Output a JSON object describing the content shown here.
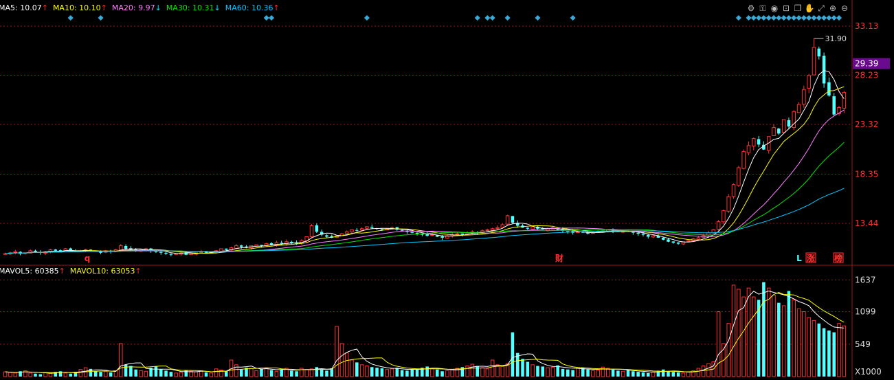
{
  "price_legend": [
    {
      "label": "MA5: 10.07",
      "arrow": "↑",
      "color": "#ffffff",
      "arrow_color": "#ff3232"
    },
    {
      "label": "MA10: 10.10",
      "arrow": "↑",
      "color": "#ffff00",
      "arrow_color": "#ff3232"
    },
    {
      "label": "MA20: 9.97",
      "arrow": "↓",
      "color": "#ff80ff",
      "arrow_color": "#00e5ff"
    },
    {
      "label": "MA30: 10.31",
      "arrow": "↓",
      "color": "#00e600",
      "arrow_color": "#00e5ff"
    },
    {
      "label": "MA60: 10.36",
      "arrow": "↑",
      "color": "#00c8ff",
      "arrow_color": "#ff3232"
    }
  ],
  "vol_legend": [
    {
      "label": "MAVOL5: 60385",
      "arrow": "↑",
      "color": "#ffffff",
      "arrow_color": "#ff3232"
    },
    {
      "label": "MAVOL10: 63053",
      "arrow": "↑",
      "color": "#ffff00",
      "arrow_color": "#ff3232"
    }
  ],
  "price_axis_labels": [
    "33.13",
    "28.23",
    "23.32",
    "18.35",
    "13.44"
  ],
  "price_highlight": "29.39",
  "max_annotation": "31.90",
  "volume_axis_labels": [
    "1637",
    "1099",
    "549"
  ],
  "volume_unit": "X1000",
  "event_markers": [
    "q",
    "财",
    "L",
    "涨",
    "榜"
  ],
  "toolbar_icons": [
    "settings-icon",
    "lock-icon",
    "eye-icon",
    "basket-icon",
    "copy-icon",
    "hand-icon",
    "resize-icon",
    "zoom-in-icon",
    "zoom-out-icon"
  ],
  "colors": {
    "up": "#ff3232",
    "down": "#54ffff",
    "grid": "#a01818",
    "axis_text": "#ff3232",
    "highlight_bg": "#6a0a8c"
  },
  "chart_data": [
    {
      "type": "candlestick",
      "y_axis_ticks": [
        33.13,
        28.23,
        23.32,
        18.35,
        13.44
      ],
      "ylim": [
        9.8,
        34.5
      ],
      "max_value": 31.9,
      "current_price": 29.39,
      "close_series": [
        10.4,
        10.5,
        10.6,
        10.4,
        10.5,
        10.7,
        10.6,
        10.5,
        10.6,
        10.8,
        10.7,
        10.6,
        10.9,
        10.7,
        10.6,
        10.7,
        10.8,
        10.7,
        10.6,
        10.5,
        10.7,
        10.6,
        10.8,
        11.2,
        10.9,
        10.8,
        10.7,
        10.8,
        10.9,
        10.7,
        10.6,
        10.5,
        10.4,
        10.3,
        10.4,
        10.5,
        10.3,
        10.4,
        10.5,
        10.6,
        10.5,
        10.6,
        10.7,
        10.9,
        10.8,
        11.0,
        11.2,
        11.1,
        11.0,
        11.2,
        11.3,
        11.2,
        11.4,
        11.3,
        11.5,
        11.4,
        11.6,
        11.5,
        11.4,
        11.7,
        12.1,
        13.2,
        12.6,
        12.3,
        12.1,
        12.0,
        12.2,
        12.4,
        12.6,
        12.8,
        12.7,
        12.9,
        13.1,
        13.0,
        12.9,
        12.8,
        12.9,
        13.0,
        12.8,
        12.7,
        12.6,
        12.5,
        12.4,
        12.3,
        12.2,
        12.3,
        12.1,
        12.0,
        12.2,
        12.3,
        12.4,
        12.3,
        12.5,
        12.6,
        12.5,
        12.7,
        12.8,
        12.9,
        13.0,
        13.3,
        14.2,
        13.5,
        13.2,
        13.0,
        12.9,
        13.1,
        12.9,
        12.8,
        12.9,
        13.0,
        12.8,
        12.7,
        12.6,
        12.5,
        12.6,
        12.5,
        12.4,
        12.5,
        12.6,
        12.7,
        12.8,
        12.7,
        12.6,
        12.7,
        12.6,
        12.5,
        12.4,
        12.3,
        12.1,
        12.2,
        12.0,
        11.8,
        11.6,
        11.5,
        11.4,
        11.6,
        11.7,
        11.9,
        12.0,
        12.2,
        12.5,
        12.8,
        13.6,
        14.7,
        16.1,
        17.3,
        19.0,
        20.6,
        21.2,
        21.9,
        21.3,
        20.8,
        22.1,
        23.0,
        22.4,
        23.8,
        23.1,
        24.6,
        25.3,
        26.8,
        28.2,
        31.0,
        30.1,
        27.4,
        26.2,
        24.3,
        25.0,
        26.5
      ],
      "ma_series": [
        "MA5",
        "MA10",
        "MA20",
        "MA30",
        "MA60"
      ]
    },
    {
      "type": "bar",
      "y_axis_ticks": [
        1637,
        1099,
        549
      ],
      "ylim": [
        0,
        1700
      ],
      "unit": "X1000",
      "values": [
        80,
        70,
        60,
        90,
        100,
        60,
        50,
        40,
        70,
        60,
        80,
        90,
        60,
        50,
        80,
        120,
        150,
        130,
        90,
        80,
        90,
        70,
        100,
        560,
        200,
        180,
        120,
        100,
        90,
        150,
        170,
        120,
        100,
        80,
        60,
        70,
        110,
        90,
        80,
        100,
        70,
        60,
        130,
        110,
        90,
        280,
        200,
        120,
        150,
        140,
        100,
        130,
        150,
        110,
        90,
        120,
        140,
        100,
        90,
        140,
        120,
        130,
        160,
        120,
        100,
        140,
        850,
        560,
        400,
        280,
        240,
        200,
        180,
        160,
        150,
        140,
        120,
        130,
        150,
        110,
        100,
        120,
        130,
        150,
        170,
        140,
        120,
        90,
        100,
        120,
        140,
        160,
        180,
        210,
        180,
        150,
        130,
        280,
        200,
        170,
        220,
        750,
        400,
        300,
        250,
        200,
        180,
        170,
        150,
        160,
        190,
        130,
        120,
        110,
        140,
        150,
        120,
        100,
        110,
        160,
        140,
        120,
        100,
        90,
        110,
        90,
        80,
        70,
        60,
        80,
        100,
        120,
        90,
        80,
        70,
        60,
        80,
        100,
        140,
        180,
        220,
        250,
        1100,
        560,
        900,
        1550,
        1480,
        1350,
        1500,
        1350,
        1300,
        1600,
        1500,
        1380,
        1250,
        1200,
        1450,
        1300,
        1150,
        1100,
        1000,
        950,
        900,
        820,
        780,
        750,
        900,
        860
      ]
    }
  ]
}
